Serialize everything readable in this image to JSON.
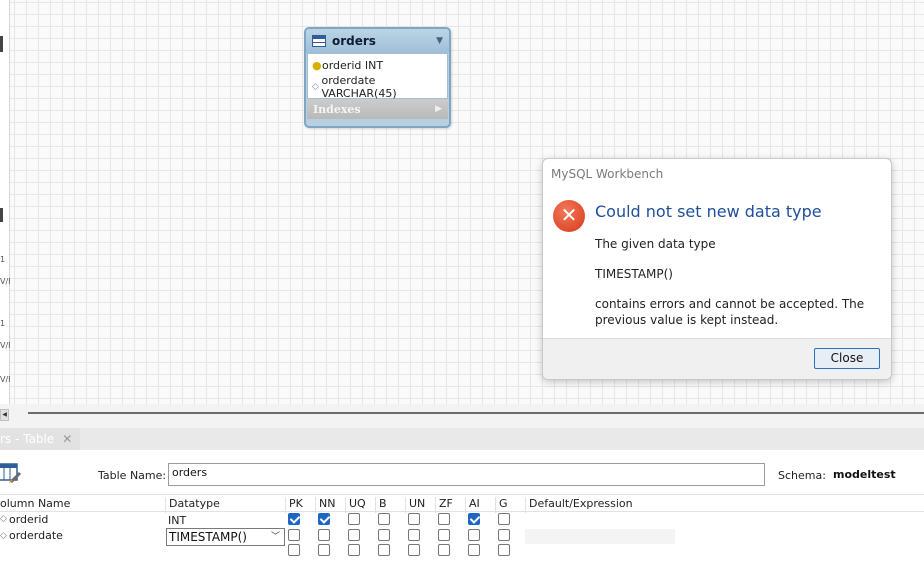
{
  "left_strip": {
    "labels": [
      "1",
      "V/F",
      "1",
      "V/F",
      "V/F"
    ]
  },
  "diagram": {
    "table": {
      "name": "orders",
      "columns": [
        {
          "icon": "primary-key-icon",
          "text": "orderid INT"
        },
        {
          "icon": "diamond-icon",
          "text": "orderdate VARCHAR(45)"
        }
      ],
      "indexes_label": "Indexes"
    }
  },
  "dialog": {
    "window_title": "MySQL Workbench",
    "heading": "Could not set new data type",
    "line1": "The given data type",
    "line2": "TIMESTAMP()",
    "line3": "contains errors and cannot be accepted. The previous value is kept instead.",
    "close_label": "Close",
    "icon": "error-x-icon"
  },
  "editor_tab": {
    "label": "rs - Table",
    "close_glyph": "✕"
  },
  "editor": {
    "table_name_label": "Table Name:",
    "table_name_value": "orders",
    "schema_label": "Schema:",
    "schema_value": "modeltest",
    "grid": {
      "headers": {
        "column_name": "olumn Name",
        "datatype": "Datatype",
        "pk": "PK",
        "nn": "NN",
        "uq": "UQ",
        "b": "B",
        "un": "UN",
        "zf": "ZF",
        "ai": "AI",
        "g": "G",
        "default": "Default/Expression"
      },
      "rows": [
        {
          "name": "orderid",
          "datatype": "INT",
          "pk": true,
          "nn": true,
          "uq": false,
          "b": false,
          "un": false,
          "zf": false,
          "ai": true,
          "g": false
        },
        {
          "name": "orderdate",
          "datatype": "TIMESTAMP()",
          "pk": false,
          "nn": false,
          "uq": false,
          "b": false,
          "un": false,
          "zf": false,
          "ai": false,
          "g": false
        }
      ]
    }
  },
  "colors": {
    "accent": "#1d66c5",
    "heading": "#1f4e9c",
    "error": "#d6381a"
  }
}
